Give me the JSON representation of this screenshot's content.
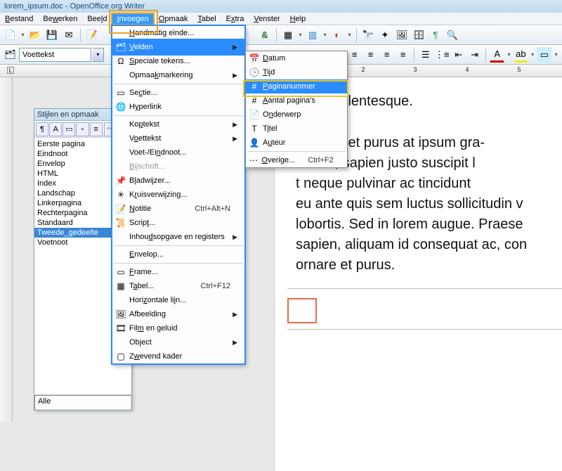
{
  "title": "lorem_ipsum.doc - OpenOffice.org Writer",
  "menubar": [
    "Bestand",
    "Bewerken",
    "Beeld",
    "Invoegen",
    "Opmaak",
    "Tabel",
    "Extra",
    "Venster",
    "Help"
  ],
  "menubar_u": [
    "B",
    "w",
    "l",
    "I",
    "O",
    "T",
    "x",
    "V",
    "H"
  ],
  "menubar_open_index": 3,
  "style_box": "Voettekst",
  "styles_panel": {
    "title": "Stijlen en opmaak",
    "items": [
      "Eerste pagina",
      "Eindnoot",
      "Envelop",
      "HTML",
      "Index",
      "Landschap",
      "Linkerpagina",
      "Rechterpagina",
      "Standaard",
      "Tweede_gedeelte",
      "Voetnoot"
    ],
    "selected_index": 9,
    "bottom": "Alle"
  },
  "doc": {
    "frag0": "…on pellentesque.",
    "p1": "disse eget purus at ipsum gra-",
    "p2": "entum, sapien justo suscipit l",
    "p3": "t neque pulvinar ac tincidunt ",
    "p4": "eu ante quis sem luctus sollicitudin v",
    "p5": "lobortis. Sed in lorem augue. Praese",
    "p6": "sapien, aliquam id consequat ac, con",
    "p7": "ornare et purus."
  },
  "menu1": [
    {
      "icon": "",
      "label": "Handmatig einde...",
      "u": "H"
    },
    {
      "icon": "🗂",
      "label": "Velden",
      "u": "V",
      "sub": true,
      "hl": true
    },
    {
      "icon": "Ω",
      "label": "Speciale tekens...",
      "u": "S"
    },
    {
      "label": "Opmaakmarkering",
      "u": "k",
      "sub": true
    },
    {
      "sep": true
    },
    {
      "icon": "▭",
      "label": "Sectie...",
      "u": "c"
    },
    {
      "icon": "🌐",
      "label": "Hyperlink",
      "u": "y"
    },
    {
      "sep": true
    },
    {
      "label": "Koptekst",
      "u": "p",
      "sub": true
    },
    {
      "label": "Voettekst",
      "u": "o",
      "sub": true
    },
    {
      "label": "Voet-/Eindnoot...",
      "u": "n"
    },
    {
      "icon": "",
      "label": "Bijschrift...",
      "u": "B",
      "dis": true
    },
    {
      "icon": "📌",
      "label": "Bladwijzer...",
      "u": "l"
    },
    {
      "icon": "✳",
      "label": "Kruisverwijzing...",
      "u": "r"
    },
    {
      "icon": "📝",
      "label": "Notitie",
      "u": "N",
      "sc": "Ctrl+Alt+N"
    },
    {
      "icon": "📜",
      "label": "Script...",
      "u": "t"
    },
    {
      "label": "Inhoudsopgave en registers",
      "u": "d",
      "sub": true
    },
    {
      "sep": true
    },
    {
      "label": "Envelop...",
      "u": "E"
    },
    {
      "sep": true
    },
    {
      "icon": "▭",
      "label": "Frame...",
      "u": "F"
    },
    {
      "icon": "▦",
      "label": "Tabel...",
      "u": "a",
      "sc": "Ctrl+F12"
    },
    {
      "label": "Horizontale lijn...",
      "u": "z"
    },
    {
      "icon": "🖼",
      "label": "Afbeelding",
      "u": "g",
      "sub": true
    },
    {
      "icon": "🎞",
      "label": "Film en geluid",
      "u": "m"
    },
    {
      "label": "Object",
      "u": "j",
      "sub": true
    },
    {
      "icon": "▢",
      "label": "Zwevend kader",
      "u": "w"
    }
  ],
  "menu2": [
    {
      "icon": "📅",
      "label": "Datum",
      "u": "D"
    },
    {
      "icon": "🕒",
      "label": "Tijd",
      "u": "T"
    },
    {
      "icon": "#",
      "label": "Paginanummer",
      "u": "P",
      "hl": true
    },
    {
      "icon": "#",
      "label": "Aantal pagina's",
      "u": "A"
    },
    {
      "icon": "📄",
      "label": "Onderwerp",
      "u": "n"
    },
    {
      "icon": "T",
      "label": "Titel",
      "u": "i"
    },
    {
      "icon": "👤",
      "label": "Auteur",
      "u": "u"
    },
    {
      "sep": true
    },
    {
      "icon": "⋯",
      "label": "Overige...",
      "u": "O",
      "sc": "Ctrl+F2"
    }
  ],
  "ruler_nums": [
    "2",
    "3",
    "4",
    "5"
  ]
}
